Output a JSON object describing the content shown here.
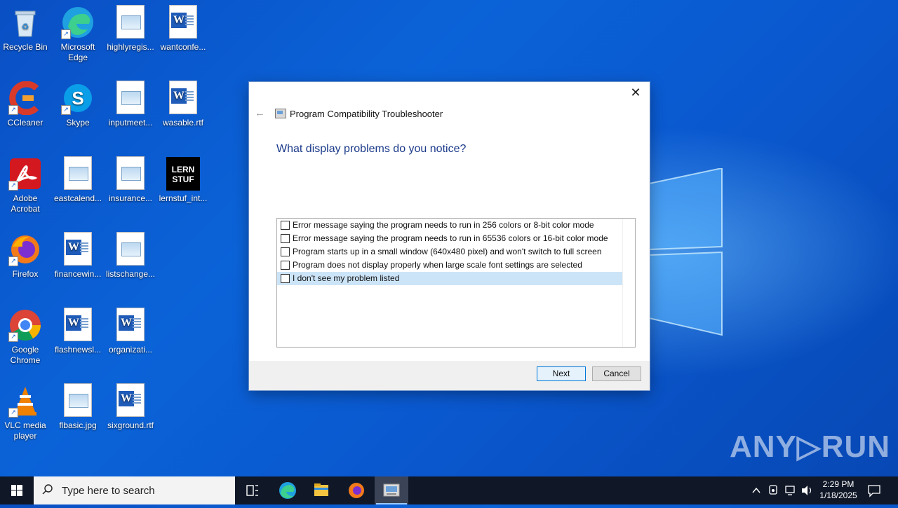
{
  "desktop": {
    "icons": [
      {
        "label": "Recycle Bin"
      },
      {
        "label": "Microsoft Edge"
      },
      {
        "label": "highlyregis..."
      },
      {
        "label": "wantconfe..."
      },
      {
        "label": "CCleaner"
      },
      {
        "label": "Skype"
      },
      {
        "label": "inputmeet..."
      },
      {
        "label": "wasable.rtf"
      },
      {
        "label": "Adobe Acrobat"
      },
      {
        "label": "eastcalend..."
      },
      {
        "label": "insurance..."
      },
      {
        "label": "lernstuf_int..."
      },
      {
        "label": "Firefox"
      },
      {
        "label": "financewin..."
      },
      {
        "label": "listschange..."
      },
      {
        "label": "Google Chrome"
      },
      {
        "label": "flashnewsl..."
      },
      {
        "label": "organizati..."
      },
      {
        "label": "VLC media player"
      },
      {
        "label": "flbasic.jpg"
      },
      {
        "label": "sixground.rtf"
      }
    ]
  },
  "dialog": {
    "title": "Program Compatibility Troubleshooter",
    "heading": "What display problems do you notice?",
    "options": [
      {
        "label": "Error message saying the program needs to run in 256 colors or 8-bit color mode",
        "checked": false
      },
      {
        "label": "Error message saying the program needs to run in 65536 colors or 16-bit color mode",
        "checked": false
      },
      {
        "label": "Program starts up in a small window (640x480 pixel) and won't switch to full screen",
        "checked": false
      },
      {
        "label": "Program does not display properly when large scale font settings are selected",
        "checked": false
      },
      {
        "label": "I don't see my problem listed",
        "checked": false,
        "selected": true
      }
    ],
    "next_label": "Next",
    "cancel_label": "Cancel"
  },
  "watermark": "ANY▷RUN",
  "taskbar": {
    "search_placeholder": "Type here to search",
    "time": "2:29 PM",
    "date": "1/18/2025"
  },
  "colors": {
    "accent": "#0078d7",
    "heading": "#1b3a8a",
    "taskbar": "#101828"
  }
}
